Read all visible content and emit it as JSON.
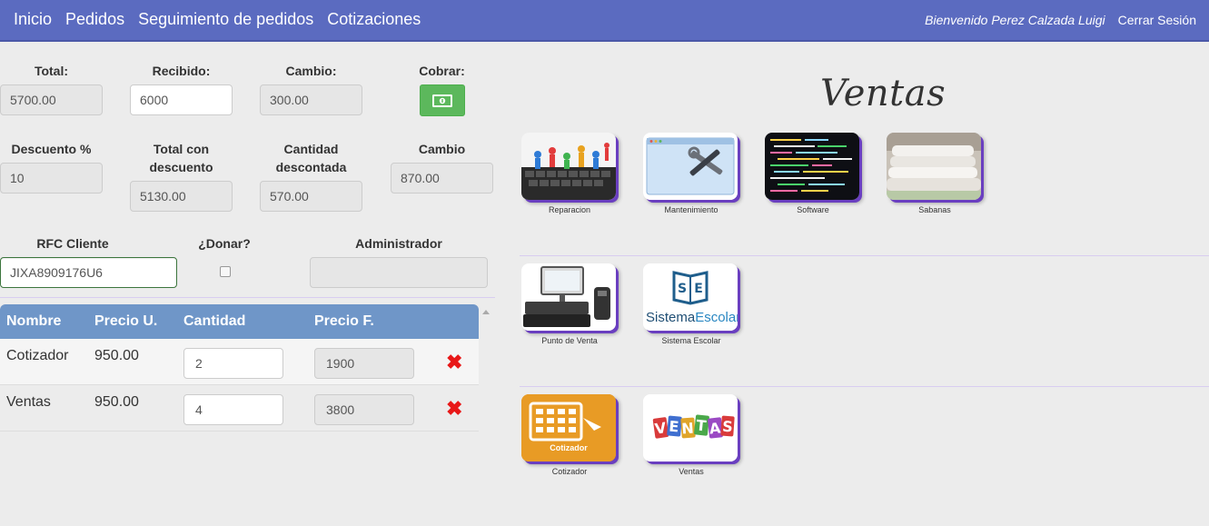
{
  "nav": {
    "links": [
      "Inicio",
      "Pedidos",
      "Seguimiento de pedidos",
      "Cotizaciones"
    ],
    "welcome": "Bienvenido Perez Calzada Luigi",
    "logout": "Cerrar Sesión"
  },
  "form": {
    "total_label": "Total:",
    "total_value": "5700.00",
    "recibido_label": "Recibido:",
    "recibido_value": "6000",
    "cambio_label": "Cambio:",
    "cambio_value": "300.00",
    "cobrar_label": "Cobrar:",
    "descuento_label": "Descuento %",
    "descuento_value": "10",
    "total_desc_label": "Total con descuento",
    "total_desc_value": "5130.00",
    "cant_desc_label": "Cantidad descontada",
    "cant_desc_value": "570.00",
    "cambio2_label": "Cambio",
    "cambio2_value": "870.00",
    "rfc_label": "RFC Cliente",
    "rfc_value": "JIXA8909176U6",
    "donar_label": "¿Donar?",
    "admin_label": "Administrador",
    "admin_value": ""
  },
  "table": {
    "headers": [
      "Nombre",
      "Precio U.",
      "Cantidad",
      "Precio F."
    ],
    "rows": [
      {
        "nombre": "Cotizador",
        "precio_u": "950.00",
        "cantidad": "2",
        "precio_f": "1900"
      },
      {
        "nombre": "Ventas",
        "precio_u": "950.00",
        "cantidad": "4",
        "precio_f": "3800"
      }
    ]
  },
  "panel": {
    "title": "Ventas",
    "tiles": [
      "Reparacion",
      "Mantenimiento",
      "Software",
      "Sabanas",
      "Punto de Venta",
      "Sistema Escolar",
      "Cotizador",
      "Ventas"
    ],
    "sistema_escolar_logo": "SE",
    "sistema_escolar_text_1": "Sistema",
    "sistema_escolar_text_2": "Escolar",
    "cotizador_logo_text": "Cotizador",
    "ventas_logo_text": "VENTAS"
  },
  "colors": {
    "navbar": "#5b6bc0",
    "table_header": "#6f96c8",
    "pay_button": "#5cb85c",
    "delete_icon": "#e81818",
    "tile_shadow": "#6a3fc0"
  }
}
